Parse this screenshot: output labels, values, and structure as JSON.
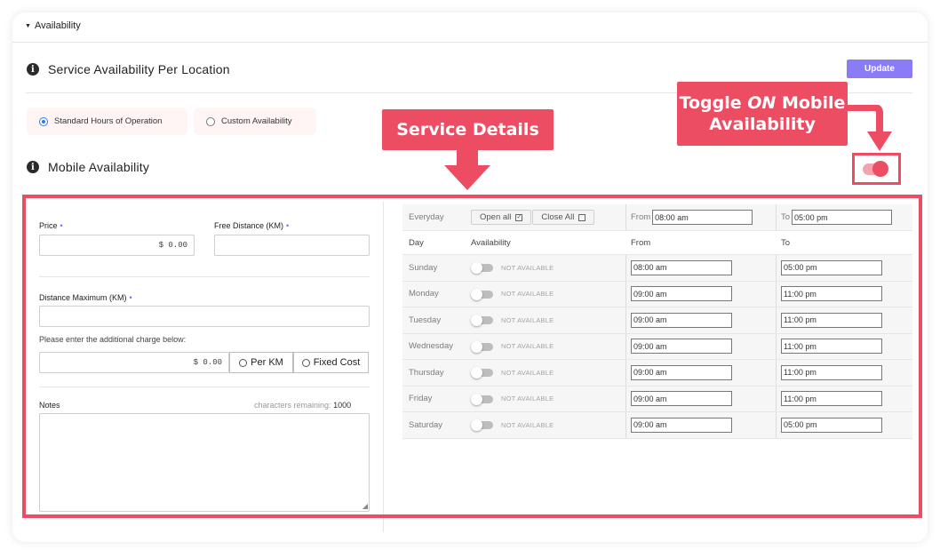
{
  "accordion": {
    "title": "Availability"
  },
  "service_availability": {
    "title": "Service Availability Per Location",
    "update_label": "Update",
    "options": [
      {
        "label": "Standard Hours of Operation",
        "selected": true
      },
      {
        "label": "Custom Availability",
        "selected": false
      }
    ]
  },
  "mobile": {
    "title": "Mobile Availability",
    "toggle_on": true
  },
  "callouts": {
    "service_details": "Service Details",
    "toggle_line1_a": "Toggle ",
    "toggle_line1_em": "ON",
    "toggle_line1_b": " Mobile",
    "toggle_line2": "Availability"
  },
  "form": {
    "price_label": "Price",
    "price_value": "$ 0.00",
    "free_distance_label": "Free Distance (KM)",
    "free_distance_value": "",
    "distance_max_label": "Distance Maximum (KM)",
    "distance_max_value": "",
    "required_mark": "•",
    "additional_charge_prompt": "Please enter the additional charge below:",
    "additional_charge_value": "$ 0.00",
    "per_km_label": "Per KM",
    "fixed_cost_label": "Fixed Cost",
    "notes_label": "Notes",
    "chars_remaining_label": "characters remaining:",
    "chars_remaining_value": "1000"
  },
  "schedule": {
    "everyday_label": "Everyday",
    "open_all_label": "Open all",
    "close_all_label": "Close All",
    "from_label": "From",
    "to_label": "To",
    "everyday_from": "08:00 am",
    "everyday_to": "05:00 pm",
    "headers": {
      "day": "Day",
      "availability": "Availability",
      "from": "From",
      "to": "To"
    },
    "not_available_label": "NOT AVAILABLE",
    "days": [
      {
        "day": "Sunday",
        "from": "08:00 am",
        "to": "05:00 pm"
      },
      {
        "day": "Monday",
        "from": "09:00 am",
        "to": "11:00 pm"
      },
      {
        "day": "Tuesday",
        "from": "09:00 am",
        "to": "11:00 pm"
      },
      {
        "day": "Wednesday",
        "from": "09:00 am",
        "to": "11:00 pm"
      },
      {
        "day": "Thursday",
        "from": "09:00 am",
        "to": "11:00 pm"
      },
      {
        "day": "Friday",
        "from": "09:00 am",
        "to": "11:00 pm"
      },
      {
        "day": "Saturday",
        "from": "09:00 am",
        "to": "05:00 pm"
      }
    ]
  },
  "colors": {
    "accent": "#ed4d63",
    "button": "#8a7cf7",
    "radio": "#2b7de9"
  }
}
